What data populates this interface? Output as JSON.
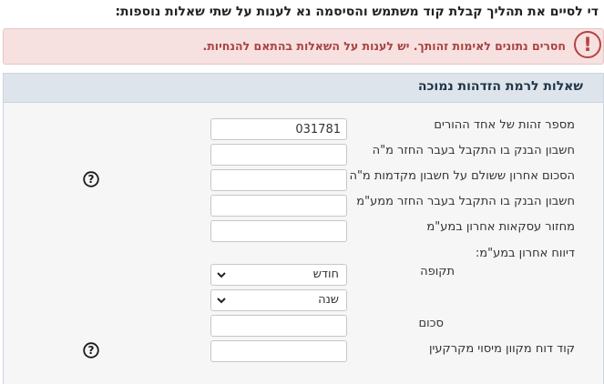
{
  "intro_text": "די לסיים את תהליך קבלת קוד משתמש והסיסמה נא לענות על שתי שאלות נוספות:",
  "alert": {
    "icon": "!",
    "message": "חסרים נתונים לאימות זהותך. יש לענות על השאלות בהתאם להנחיות."
  },
  "panel": {
    "title": "שאלות לרמת הזדהות נמוכה"
  },
  "fields": {
    "parent_id": {
      "label": "מספר זהות של אחד ההורים",
      "value": "031781"
    },
    "bank_income_tax": {
      "label": "חשבון הבנק בו התקבל בעבר החזר מ\"ה",
      "value": ""
    },
    "last_advance_payment": {
      "label": "הסכום אחרון ששולם על חשבון מקדמות מ\"ה",
      "value": ""
    },
    "bank_vat_refund": {
      "label": "חשבון הבנק בו התקבל בעבר החזר ממע\"מ",
      "value": ""
    },
    "last_vat_turnover": {
      "label": "מחזור עסקאות אחרון במע\"מ",
      "value": ""
    }
  },
  "vat_report": {
    "heading": "דיווח אחרון במע\"מ:",
    "period_label": "תקופה",
    "month_value": "חודש",
    "year_value": "שנה",
    "amount_label": "סכום",
    "amount_value": ""
  },
  "real_estate": {
    "label": "קוד דוח מקוון מיסוי מקרקעין",
    "value": ""
  },
  "help_glyph": "?"
}
